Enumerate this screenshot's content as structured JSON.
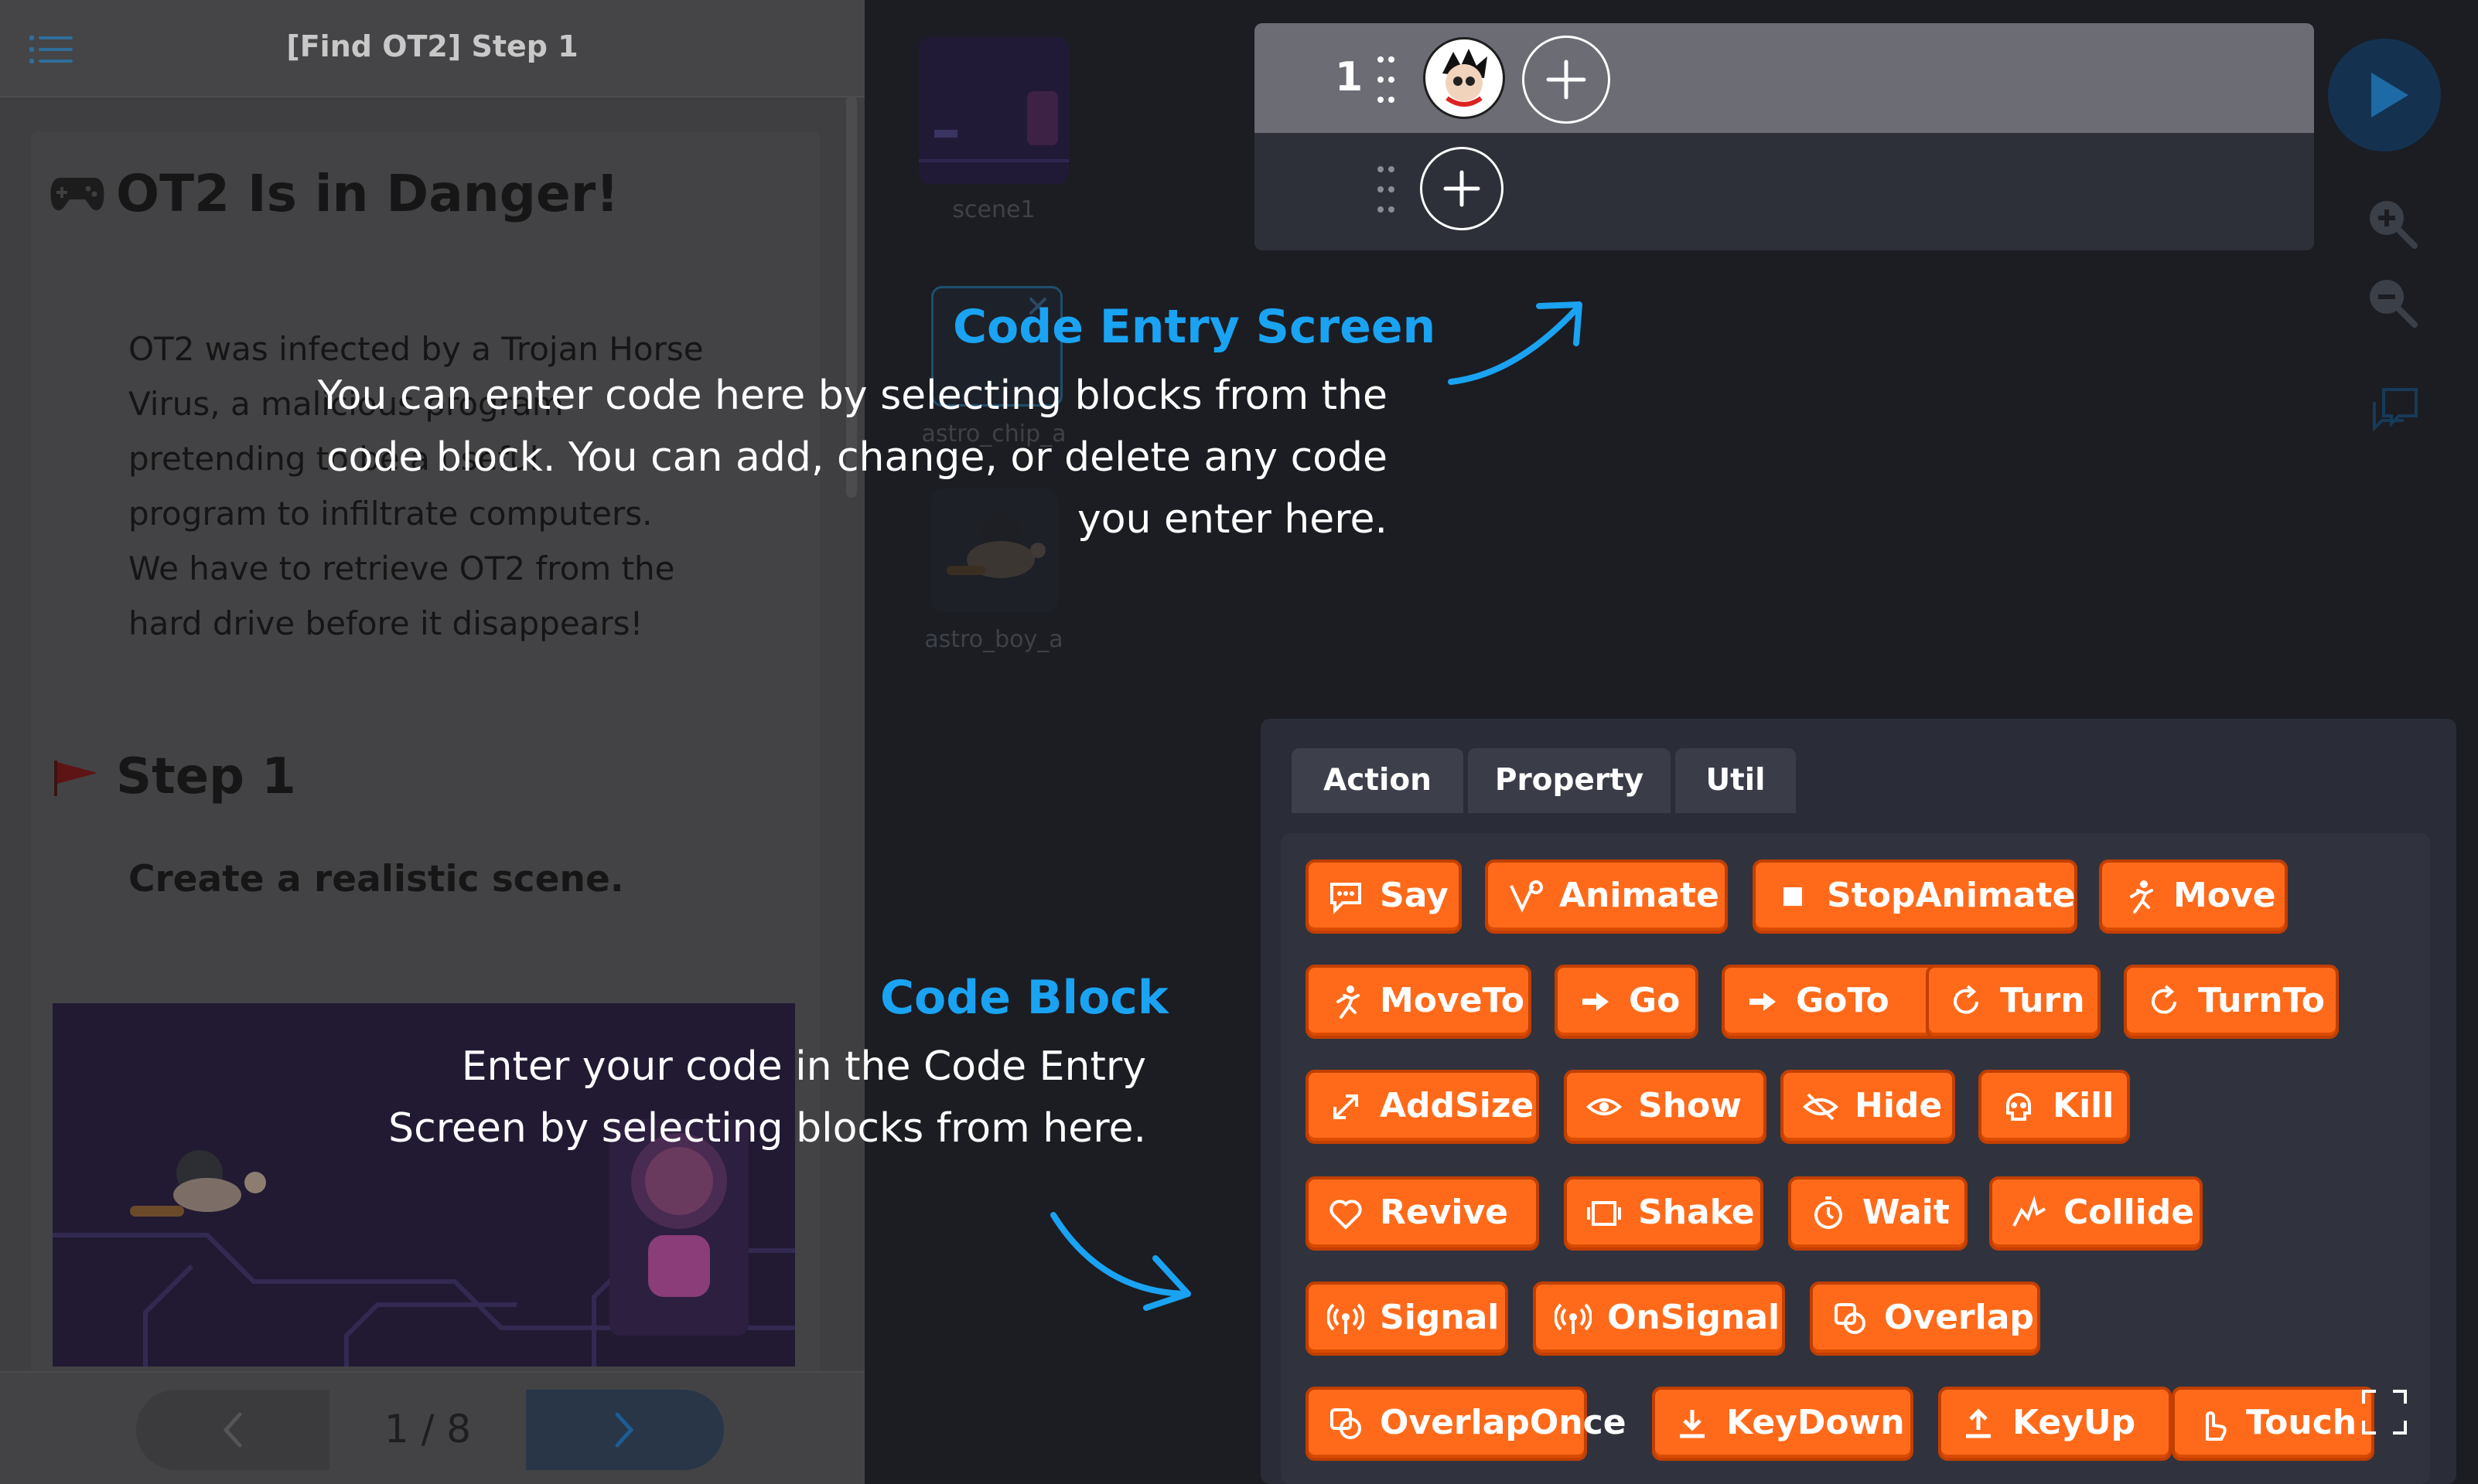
{
  "lesson": {
    "header_title": "[Find OT2] Step 1",
    "title": "OT2 Is in Danger!",
    "paragraph_lines": [
      "OT2 was infected by a Trojan Horse",
      "Virus, a malicious program",
      "pretending to be a useful",
      "program to infiltrate computers.",
      "We have to retrieve OT2 from the",
      "hard drive before it disappears!"
    ],
    "step_title": "Step 1",
    "step_subtitle": "Create a realistic scene.",
    "page_indicator": "1 / 8"
  },
  "scenes": [
    {
      "label": "scene1"
    },
    {
      "label": "astro_chip_a"
    },
    {
      "label": "astro_boy_a"
    }
  ],
  "code_entry": {
    "row_number": "1"
  },
  "tabs": [
    {
      "label": "Action"
    },
    {
      "label": "Property"
    },
    {
      "label": "Util"
    }
  ],
  "blocks": [
    {
      "label": "Say",
      "icon": "speech-bubble-icon"
    },
    {
      "label": "Animate",
      "icon": "animate-icon"
    },
    {
      "label": "StopAnimate",
      "icon": "stop-icon"
    },
    {
      "label": "Move",
      "icon": "running-icon"
    },
    {
      "label": "MoveTo",
      "icon": "running-icon"
    },
    {
      "label": "Go",
      "icon": "arrow-right-icon"
    },
    {
      "label": "GoTo",
      "icon": "arrow-right-icon"
    },
    {
      "label": "Turn",
      "icon": "rotate-icon"
    },
    {
      "label": "TurnTo",
      "icon": "rotate-icon"
    },
    {
      "label": "AddSize",
      "icon": "resize-icon"
    },
    {
      "label": "Show",
      "icon": "eye-icon"
    },
    {
      "label": "Hide",
      "icon": "eye-off-icon"
    },
    {
      "label": "Kill",
      "icon": "skull-icon"
    },
    {
      "label": "Revive",
      "icon": "heart-icon"
    },
    {
      "label": "Shake",
      "icon": "shake-icon"
    },
    {
      "label": "Wait",
      "icon": "timer-icon"
    },
    {
      "label": "Collide",
      "icon": "collide-icon"
    },
    {
      "label": "Signal",
      "icon": "broadcast-icon"
    },
    {
      "label": "OnSignal",
      "icon": "broadcast-icon"
    },
    {
      "label": "Overlap",
      "icon": "overlap-icon"
    },
    {
      "label": "OverlapOnce",
      "icon": "overlap-icon"
    },
    {
      "label": "KeyDown",
      "icon": "download-icon"
    },
    {
      "label": "KeyUp",
      "icon": "upload-icon"
    },
    {
      "label": "Touch",
      "icon": "touch-icon"
    }
  ],
  "callouts": {
    "code_entry": {
      "title": "Code Entry Screen",
      "lines": [
        "You can enter code here by selecting blocks from the",
        "code block. You can add, change, or delete any code",
        "you enter here."
      ]
    },
    "code_block": {
      "title": "Code Block",
      "lines": [
        "Enter your code in the Code Entry",
        "Screen by selecting blocks from here."
      ]
    }
  },
  "colors": {
    "block_orange": "#ff6a1a",
    "callout_blue": "#1aa3f2",
    "run_button": "#143250"
  }
}
